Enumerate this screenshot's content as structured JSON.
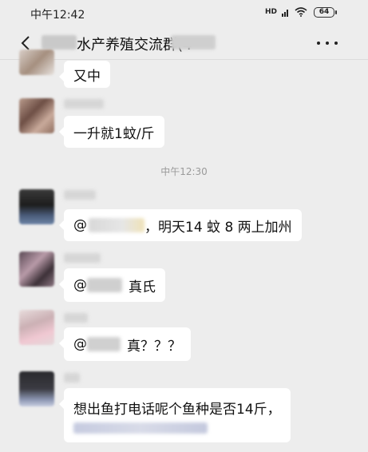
{
  "status_bar": {
    "time": "中午12:42",
    "network": "HD",
    "battery": "64"
  },
  "nav": {
    "title": "水产养殖交流群(4"
  },
  "timestamp": "中午12:30",
  "messages": [
    {
      "text": "又中"
    },
    {
      "text": "一升就1蚊/斤"
    },
    {
      "prefix": "@",
      "text": "，明天14 蚊 8 两上加州"
    },
    {
      "prefix": "@",
      "text": "真氏"
    },
    {
      "prefix": "@",
      "text": "真？？？"
    },
    {
      "text": "想出鱼打电话呢个鱼种是否14斤，"
    }
  ]
}
